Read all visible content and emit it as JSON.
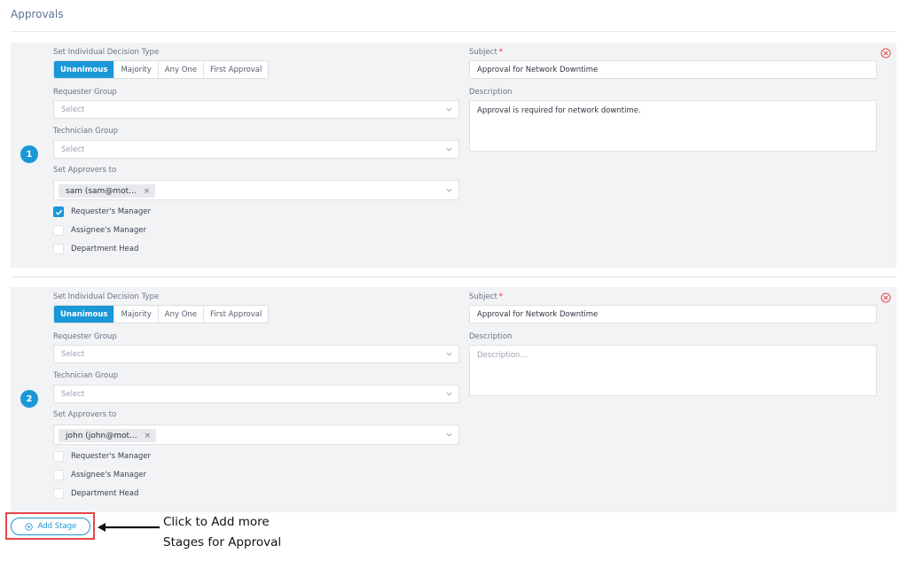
{
  "page": {
    "title": "Approvals"
  },
  "labels": {
    "decision_type": "Set Individual Decision Type",
    "requester_group": "Requester Group",
    "technician_group": "Technician Group",
    "set_approvers": "Set Approvers to",
    "subject": "Subject",
    "description": "Description"
  },
  "decision_options": [
    "Unanimous",
    "Majority",
    "Any One",
    "First Approval"
  ],
  "checkbox_labels": [
    "Requester's Manager",
    "Assignee's Manager",
    "Department Head"
  ],
  "stages": [
    {
      "number": "1",
      "decision_type": "Unanimous",
      "requester_group": {
        "placeholder": "Select"
      },
      "technician_group": {
        "placeholder": "Select"
      },
      "approvers": [
        "sam (sam@mot..."
      ],
      "checkboxes": [
        true,
        false,
        false
      ],
      "subject": "Approval for Network Downtime",
      "description": "Approval is required for network downtime."
    },
    {
      "number": "2",
      "decision_type": "Unanimous",
      "requester_group": {
        "placeholder": "Select"
      },
      "technician_group": {
        "placeholder": "Select"
      },
      "approvers": [
        "john (john@mot..."
      ],
      "checkboxes": [
        false,
        false,
        false
      ],
      "subject": "Approval for Network Downtime",
      "description_placeholder": "Description..."
    }
  ],
  "add_stage_label": "Add Stage",
  "annotation": {
    "line1": "Click to Add more",
    "line2": "Stages for Approval"
  },
  "icons": {
    "remove": "remove-circle-icon",
    "chevron": "chevron-down-icon",
    "check": "check-icon",
    "add": "plus-circle-icon",
    "arrow": "arrow-left-icon"
  },
  "colors": {
    "accent": "#1a97d6",
    "remove": "#e5474b",
    "highlight": "#e5474b",
    "stage_bg": "#f2f3f5"
  }
}
